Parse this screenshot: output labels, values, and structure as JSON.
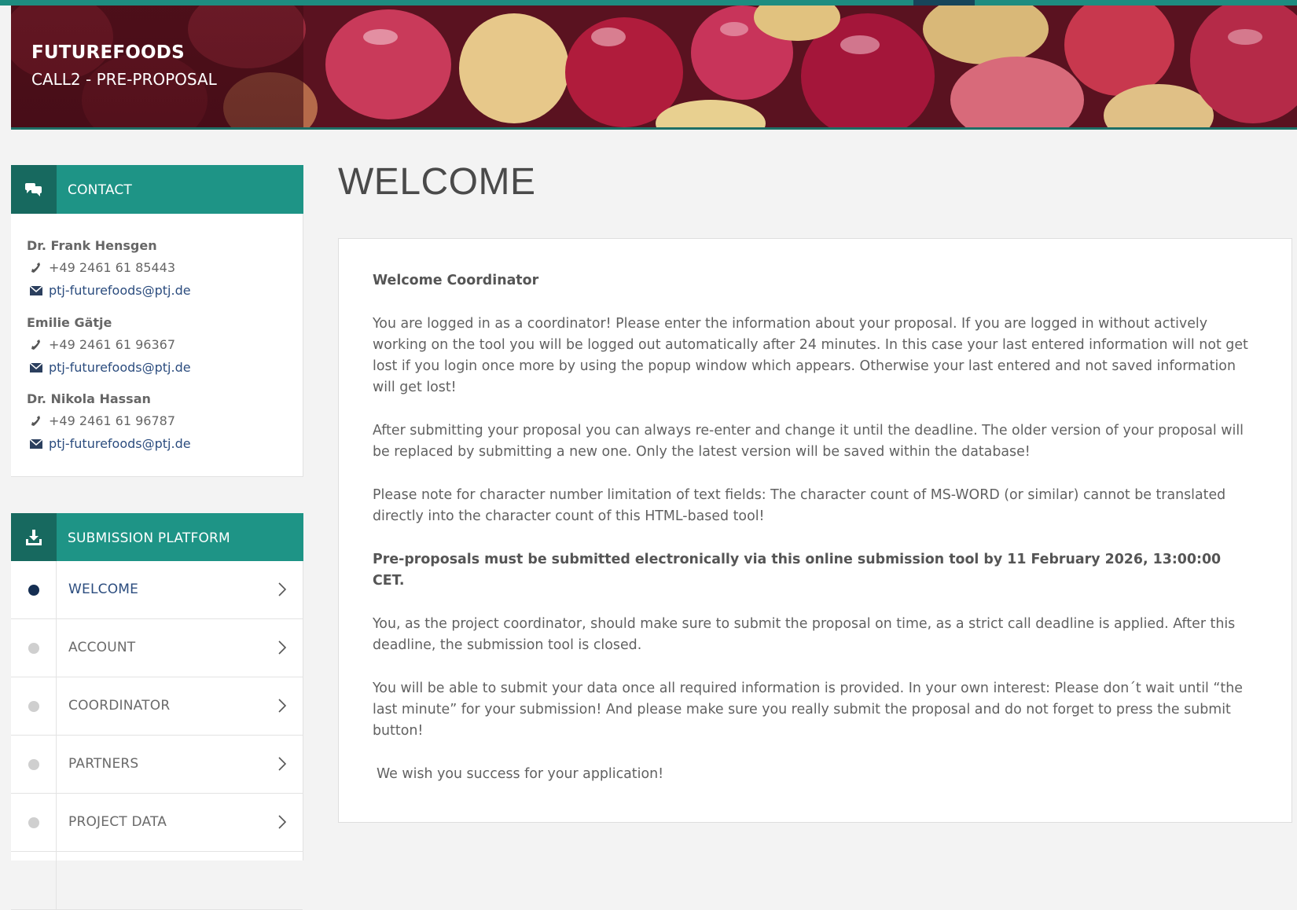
{
  "header": {
    "title": "FUTUREFOODS",
    "subtitle": "CALL2 - PRE-PROPOSAL"
  },
  "colors": {
    "accent": "#1e9486",
    "accent_dark": "#17695f",
    "active_dot": "#152e52",
    "link": "#2b4c7e"
  },
  "contact": {
    "heading": "CONTACT",
    "icon": "chat-bubbles-icon",
    "people": [
      {
        "name": "Dr. Frank Hensgen",
        "phone": "+49 2461 61 85443",
        "email": "ptj-futurefoods@ptj.de"
      },
      {
        "name": "Emilie Gätje",
        "phone": "+49 2461 61 96367",
        "email": "ptj-futurefoods@ptj.de"
      },
      {
        "name": "Dr. Nikola Hassan",
        "phone": "+49 2461 61 96787",
        "email": "ptj-futurefoods@ptj.de"
      }
    ]
  },
  "submission": {
    "heading": "SUBMISSION PLATFORM",
    "icon": "download-tray-icon",
    "items": [
      {
        "label": "WELCOME",
        "active": true
      },
      {
        "label": "ACCOUNT",
        "active": false
      },
      {
        "label": "COORDINATOR",
        "active": false
      },
      {
        "label": "PARTNERS",
        "active": false
      },
      {
        "label": "PROJECT DATA",
        "active": false
      }
    ]
  },
  "main": {
    "title": "WELCOME",
    "greeting": "Welcome Coordinator",
    "para1": "You are logged in as a coordinator! Please enter the information about your proposal. If you are logged in without actively working on the tool you will be logged out automatically after 24 minutes. In this case your last entered information will not get lost if you login once more by using the popup window which appears. Otherwise your last entered and not saved information will get lost!",
    "para2": "After submitting your proposal you can always re-enter and change it until the deadline. The older version of your proposal will be replaced by submitting a new one. Only the latest version will be saved within the database!",
    "para3": "Please note for character number limitation of text fields: The character count of MS-WORD (or similar) cannot be translated directly into the character count of this HTML-based tool!",
    "deadline": "Pre-proposals must be submitted electronically via this online submission tool by 11 February 2026, 13:00:00 CET.",
    "para4": "You, as the project coordinator, should make sure to submit the proposal on time, as a strict call deadline is applied. After this deadline, the submission tool is closed.",
    "para5": "You will be able to submit your data once all required information is provided. In your own interest: Please don´t wait until “the last minute” for your submission! And please make sure you really submit the proposal and do not forget to press the submit button!",
    "closing": "We wish you success for your application!"
  }
}
